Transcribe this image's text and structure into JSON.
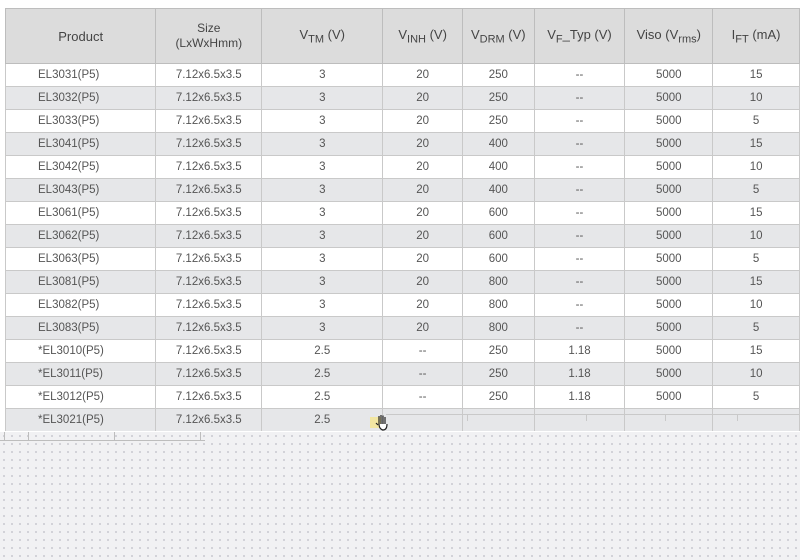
{
  "table": {
    "headers": {
      "product": "Product",
      "size_line1": "Size",
      "size_line2": "(LxWxHmm)",
      "vtm_main": "V",
      "vtm_sub": "TM",
      "vtm_unit": " (V)",
      "vinh_main": "V",
      "vinh_sub": "INH",
      "vinh_unit": " (V)",
      "vdrm_main": "V",
      "vdrm_sub": "DRM",
      "vdrm_unit": " (V)",
      "vf_main": "V",
      "vf_sub": "F",
      "vf_unit": "_Typ (V)",
      "viso_main": "Viso (V",
      "viso_sub": "rms",
      "viso_unit": ")",
      "ift_main": "I",
      "ift_sub": "FT",
      "ift_unit": " (mA)"
    },
    "rows": [
      {
        "product": "EL3031(P5)",
        "size": "7.12x6.5x3.5",
        "vtm": "3",
        "vinh": "20",
        "vdrm": "250",
        "vf": "--",
        "viso": "5000",
        "ift": "15"
      },
      {
        "product": "EL3032(P5)",
        "size": "7.12x6.5x3.5",
        "vtm": "3",
        "vinh": "20",
        "vdrm": "250",
        "vf": "--",
        "viso": "5000",
        "ift": "10"
      },
      {
        "product": "EL3033(P5)",
        "size": "7.12x6.5x3.5",
        "vtm": "3",
        "vinh": "20",
        "vdrm": "250",
        "vf": "--",
        "viso": "5000",
        "ift": "5"
      },
      {
        "product": "EL3041(P5)",
        "size": "7.12x6.5x3.5",
        "vtm": "3",
        "vinh": "20",
        "vdrm": "400",
        "vf": "--",
        "viso": "5000",
        "ift": "15"
      },
      {
        "product": "EL3042(P5)",
        "size": "7.12x6.5x3.5",
        "vtm": "3",
        "vinh": "20",
        "vdrm": "400",
        "vf": "--",
        "viso": "5000",
        "ift": "10"
      },
      {
        "product": "EL3043(P5)",
        "size": "7.12x6.5x3.5",
        "vtm": "3",
        "vinh": "20",
        "vdrm": "400",
        "vf": "--",
        "viso": "5000",
        "ift": "5"
      },
      {
        "product": "EL3061(P5)",
        "size": "7.12x6.5x3.5",
        "vtm": "3",
        "vinh": "20",
        "vdrm": "600",
        "vf": "--",
        "viso": "5000",
        "ift": "15"
      },
      {
        "product": "EL3062(P5)",
        "size": "7.12x6.5x3.5",
        "vtm": "3",
        "vinh": "20",
        "vdrm": "600",
        "vf": "--",
        "viso": "5000",
        "ift": "10"
      },
      {
        "product": "EL3063(P5)",
        "size": "7.12x6.5x3.5",
        "vtm": "3",
        "vinh": "20",
        "vdrm": "600",
        "vf": "--",
        "viso": "5000",
        "ift": "5"
      },
      {
        "product": "EL3081(P5)",
        "size": "7.12x6.5x3.5",
        "vtm": "3",
        "vinh": "20",
        "vdrm": "800",
        "vf": "--",
        "viso": "5000",
        "ift": "15"
      },
      {
        "product": "EL3082(P5)",
        "size": "7.12x6.5x3.5",
        "vtm": "3",
        "vinh": "20",
        "vdrm": "800",
        "vf": "--",
        "viso": "5000",
        "ift": "10"
      },
      {
        "product": "EL3083(P5)",
        "size": "7.12x6.5x3.5",
        "vtm": "3",
        "vinh": "20",
        "vdrm": "800",
        "vf": "--",
        "viso": "5000",
        "ift": "5"
      },
      {
        "product": "*EL3010(P5)",
        "size": "7.12x6.5x3.5",
        "vtm": "2.5",
        "vinh": "--",
        "vdrm": "250",
        "vf": "1.18",
        "viso": "5000",
        "ift": "15"
      },
      {
        "product": "*EL3011(P5)",
        "size": "7.12x6.5x3.5",
        "vtm": "2.5",
        "vinh": "--",
        "vdrm": "250",
        "vf": "1.18",
        "viso": "5000",
        "ift": "10"
      },
      {
        "product": "*EL3012(P5)",
        "size": "7.12x6.5x3.5",
        "vtm": "2.5",
        "vinh": "--",
        "vdrm": "250",
        "vf": "1.18",
        "viso": "5000",
        "ift": "5"
      },
      {
        "product": "*EL3021(P5)",
        "size": "7.12x6.5x3.5",
        "vtm": "2.5",
        "vinh": "",
        "vdrm": "",
        "vf": "",
        "viso": "",
        "ift": ""
      }
    ]
  },
  "cursor": {
    "icon": "hand-grab-cursor-icon"
  },
  "colors": {
    "header_bg": "#dcdcdc",
    "row_alt_bg": "#e6e7e9",
    "border": "#c9c9c9",
    "text": "#555555"
  }
}
